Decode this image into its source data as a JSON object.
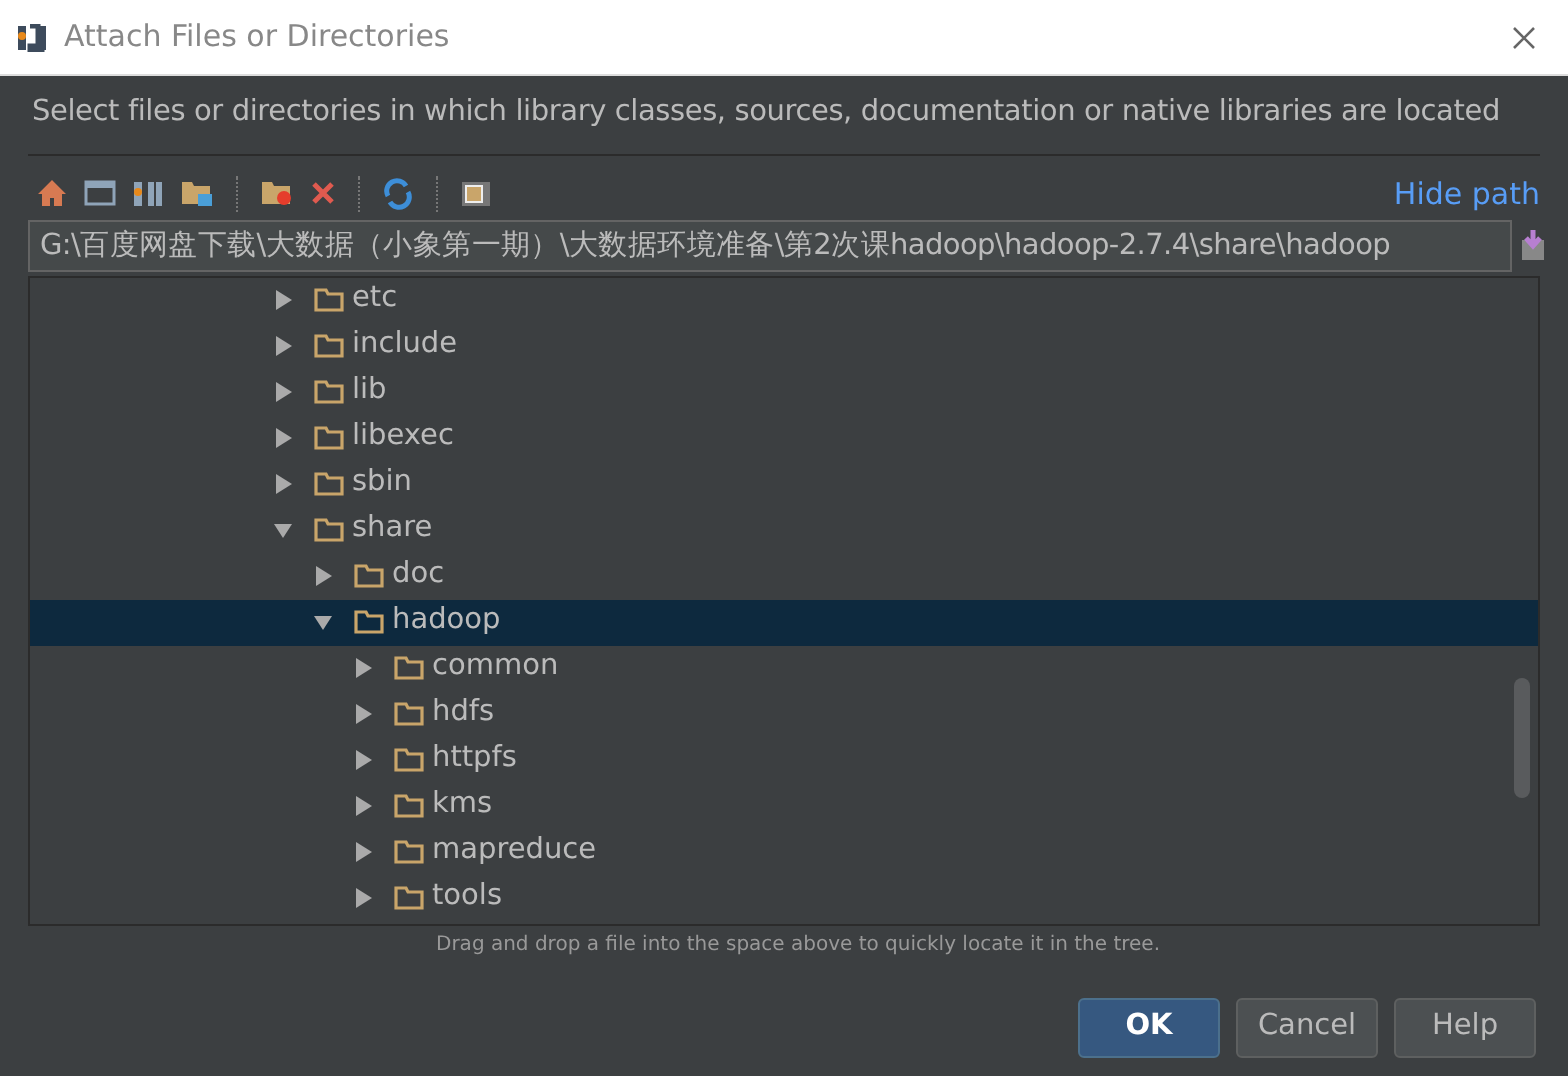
{
  "window": {
    "title": "Attach Files or Directories"
  },
  "description": "Select files or directories in which library classes, sources, documentation or native libraries are located",
  "toolbar": {
    "hide_path_link": "Hide path"
  },
  "path_field": {
    "value": "G:\\百度网盘下载\\大数据（小象第一期）\\大数据环境准备\\第2次课hadoop\\hadoop-2.7.4\\share\\hadoop"
  },
  "tree": [
    {
      "label": "etc",
      "expanded": false,
      "selected": false
    },
    {
      "label": "include",
      "expanded": false,
      "selected": false
    },
    {
      "label": "lib",
      "expanded": false,
      "selected": false
    },
    {
      "label": "libexec",
      "expanded": false,
      "selected": false
    },
    {
      "label": "sbin",
      "expanded": false,
      "selected": false
    },
    {
      "label": "share",
      "expanded": true,
      "selected": false,
      "children": [
        {
          "label": "doc",
          "expanded": false,
          "selected": false
        },
        {
          "label": "hadoop",
          "expanded": true,
          "selected": true,
          "children": [
            {
              "label": "common",
              "expanded": false,
              "selected": false
            },
            {
              "label": "hdfs",
              "expanded": false,
              "selected": false
            },
            {
              "label": "httpfs",
              "expanded": false,
              "selected": false
            },
            {
              "label": "kms",
              "expanded": false,
              "selected": false
            },
            {
              "label": "mapreduce",
              "expanded": false,
              "selected": false
            },
            {
              "label": "tools",
              "expanded": false,
              "selected": false
            }
          ]
        }
      ]
    }
  ],
  "hint": "Drag and drop a file into the space above to quickly locate it in the tree.",
  "buttons": [
    {
      "label": "OK",
      "kind": "primary"
    },
    {
      "label": "Cancel",
      "kind": "secondary"
    },
    {
      "label": "Help",
      "kind": "secondary"
    }
  ]
}
